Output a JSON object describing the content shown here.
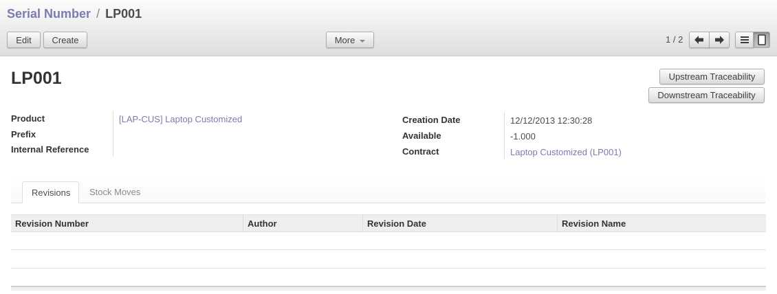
{
  "breadcrumb": {
    "parent": "Serial Number",
    "separator": "/",
    "current": "LP001"
  },
  "toolbar": {
    "edit_label": "Edit",
    "create_label": "Create",
    "more_label": "More"
  },
  "pager": {
    "text": "1 / 2"
  },
  "icons": {
    "prev": "arrow-left-icon",
    "next": "arrow-right-icon",
    "list_view": "list-view-icon",
    "form_view": "form-view-icon",
    "dropdown": "caret-down-icon"
  },
  "colors": {
    "link": "#7c7bad",
    "text": "#4c4c4c"
  },
  "record": {
    "title": "LP001"
  },
  "actions": {
    "upstream_label": "Upstream Traceability",
    "downstream_label": "Downstream Traceability"
  },
  "fields_left": {
    "product_label": "Product",
    "product_value": "[LAP-CUS] Laptop Customized",
    "prefix_label": "Prefix",
    "prefix_value": "",
    "internal_ref_label": "Internal Reference",
    "internal_ref_value": ""
  },
  "fields_right": {
    "creation_date_label": "Creation Date",
    "creation_date_value": "12/12/2013 12:30:28",
    "available_label": "Available",
    "available_value": "-1.000",
    "contract_label": "Contract",
    "contract_value": "Laptop Customized (LP001)"
  },
  "tabs": [
    {
      "label": "Revisions",
      "active": true
    },
    {
      "label": "Stock Moves",
      "active": false
    }
  ],
  "table": {
    "columns": [
      "Revision Number",
      "Author",
      "Revision Date",
      "Revision Name"
    ],
    "rows": []
  }
}
